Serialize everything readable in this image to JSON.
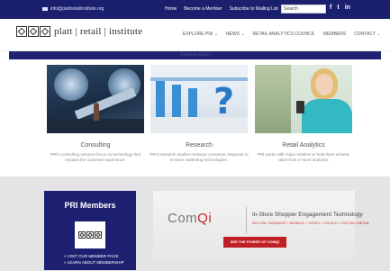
{
  "topbar": {
    "email": "info@plattretailinstitute.org",
    "links": [
      "Home",
      "Become a Member",
      "Subscribe to Mailing List"
    ],
    "search_placeholder": "Search",
    "social": [
      "f",
      "t",
      "in"
    ]
  },
  "header": {
    "logo_text": "platt | retail | institute",
    "nav": [
      "EXPLORE PRI ⌄",
      "NEWS ⌄",
      "RETAIL ANALYTICS COUNCIL",
      "MEMBERS",
      "CONTACT ⌄"
    ]
  },
  "banner": {
    "text": "Retail Analytics"
  },
  "cards": [
    {
      "title": "Consulting",
      "desc": "PRI's consulting services focus on technology that impacts the customer experience."
    },
    {
      "title": "Research",
      "desc": "PRI's research studies measure consumer response to in-store marketing technologies."
    },
    {
      "title": "Retail Analytics",
      "desc": "PRI works with major retailers to help them achieve value from in-store analytics."
    }
  ],
  "members": {
    "title": "PRI Members",
    "link1": "» VISIT OUR MEMBER PAGE",
    "link2": "» LEARN ABOUT MEMBERSHIP"
  },
  "ad": {
    "logo_prefix": "Com",
    "logo_accent": "Qi",
    "headline": "In-Store Shopper Engagement Technology",
    "sub": "DIGITAL SIGNAGE • MOBILE • VIDEO • TOUCH • SOCIAL MEDIA",
    "cta": "SEE THE POWER OF COMQI"
  },
  "colors": {
    "navy": "#1a1f6e",
    "accent_red": "#c01f26"
  }
}
